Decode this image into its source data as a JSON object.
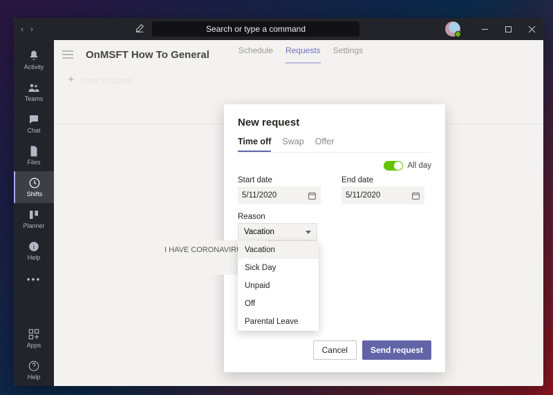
{
  "titlebar": {
    "search_placeholder": "Search or type a command"
  },
  "rail": {
    "items": [
      {
        "id": "activity",
        "label": "Activity",
        "icon": "bell"
      },
      {
        "id": "teams",
        "label": "Teams",
        "icon": "teams"
      },
      {
        "id": "chat",
        "label": "Chat",
        "icon": "chat"
      },
      {
        "id": "files",
        "label": "Files",
        "icon": "files"
      },
      {
        "id": "shifts",
        "label": "Shifts",
        "icon": "shifts",
        "active": true
      },
      {
        "id": "planner",
        "label": "Planner",
        "icon": "planner"
      },
      {
        "id": "help",
        "label": "Help",
        "icon": "help"
      }
    ],
    "bottom": [
      {
        "id": "apps",
        "label": "Apps",
        "icon": "apps"
      },
      {
        "id": "help-b",
        "label": "Help",
        "icon": "help"
      }
    ]
  },
  "main": {
    "team_title": "OnMSFT How To General",
    "tabs": {
      "schedule": "Schedule",
      "requests": "Requests",
      "settings": "Settings"
    },
    "new_request_btn": "New request"
  },
  "modal": {
    "title": "New request",
    "tabs": {
      "timeoff": "Time off",
      "swap": "Swap",
      "offer": "Offer"
    },
    "allday_label": "All day",
    "allday_on": true,
    "start": {
      "label": "Start date",
      "value": "5/11/2020"
    },
    "end": {
      "label": "End date",
      "value": "5/11/2020"
    },
    "reason": {
      "label": "Reason",
      "selected": "Vacation",
      "options": [
        "Vacation",
        "Sick Day",
        "Unpaid",
        "Off",
        "Parental Leave"
      ]
    },
    "note_text": "I HAVE CORONAVIRUS",
    "actions": {
      "cancel": "Cancel",
      "send": "Send request"
    }
  }
}
